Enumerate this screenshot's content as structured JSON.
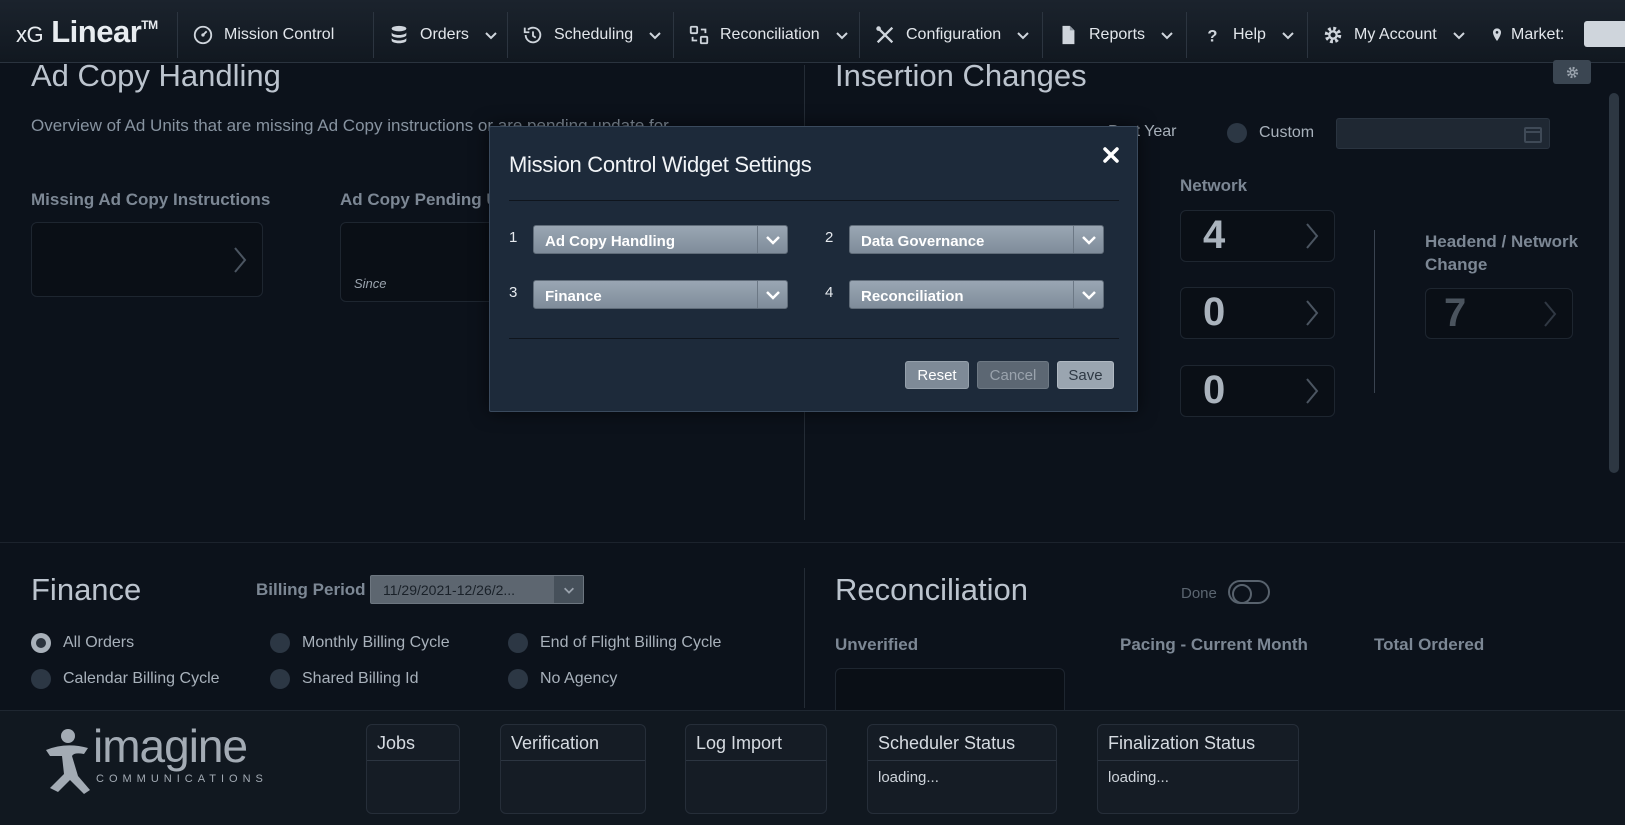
{
  "app": {
    "brand_prefix": "xG",
    "brand_name": "Linear",
    "brand_tm": "TM"
  },
  "nav": {
    "items": [
      {
        "label": "Mission Control",
        "icon": "gauge-icon"
      },
      {
        "label": "Orders",
        "icon": "database-icon"
      },
      {
        "label": "Scheduling",
        "icon": "history-icon"
      },
      {
        "label": "Reconciliation",
        "icon": "reconcile-icon"
      },
      {
        "label": "Configuration",
        "icon": "tools-icon"
      },
      {
        "label": "Reports",
        "icon": "document-icon"
      },
      {
        "label": "Help",
        "icon": "question-icon"
      },
      {
        "label": "My Account",
        "icon": "gear-icon"
      }
    ],
    "market_label": "Market:"
  },
  "ad_copy": {
    "title": "Ad Copy Handling",
    "description": "Overview of Ad Units that are missing Ad Copy instructions or are pending update for Ad Copy",
    "missing_label": "Missing Ad Copy Instructions",
    "pending_label": "Ad Copy Pending Up",
    "since_label": "Since"
  },
  "insertion": {
    "title": "Insertion Changes",
    "range_options": [
      "Past Year",
      "Custom"
    ],
    "network_label": "Network",
    "network_values": [
      "4",
      "0",
      "0"
    ],
    "headend_label": "Headend / Network Change",
    "headend_value": "7"
  },
  "finance": {
    "title": "Finance",
    "billing_label": "Billing Period",
    "billing_value": "11/29/2021-12/26/2...",
    "options": [
      "All Orders",
      "Monthly Billing Cycle",
      "End of Flight Billing Cycle",
      "Calendar Billing Cycle",
      "Shared Billing Id",
      "No Agency"
    ]
  },
  "reconciliation": {
    "title": "Reconciliation",
    "done_label": "Done",
    "unverified_label": "Unverified",
    "pacing_label": "Pacing - Current Month",
    "total_label": "Total Ordered"
  },
  "footer": {
    "logo_word": "imagine",
    "logo_sub": "COMMUNICATIONS",
    "boxes": [
      {
        "title": "Jobs",
        "body": ""
      },
      {
        "title": "Verification",
        "body": ""
      },
      {
        "title": "Log Import",
        "body": ""
      },
      {
        "title": "Scheduler Status",
        "body": "loading..."
      },
      {
        "title": "Finalization Status",
        "body": "loading..."
      }
    ]
  },
  "modal": {
    "title": "Mission Control Widget Settings",
    "slots": [
      {
        "num": "1",
        "value": "Ad Copy Handling"
      },
      {
        "num": "2",
        "value": "Data Governance"
      },
      {
        "num": "3",
        "value": "Finance"
      },
      {
        "num": "4",
        "value": "Reconciliation"
      }
    ],
    "reset_label": "Reset",
    "cancel_label": "Cancel",
    "save_label": "Save"
  }
}
